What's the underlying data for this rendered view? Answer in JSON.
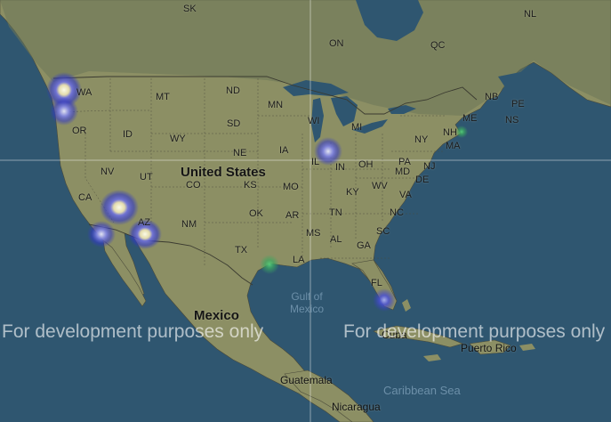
{
  "map": {
    "country_labels": {
      "united_states": "United States",
      "mexico": "Mexico"
    },
    "region_labels": {
      "sk": "SK",
      "on": "ON",
      "qc": "QC",
      "nl": "NL",
      "nb": "NB",
      "pe": "PE",
      "ns": "NS",
      "wa": "WA",
      "or": "OR",
      "id": "ID",
      "mt": "MT",
      "wy": "WY",
      "nd": "ND",
      "sd": "SD",
      "ne": "NE",
      "nv": "NV",
      "ut": "UT",
      "co": "CO",
      "ks": "KS",
      "ca": "CA",
      "az": "AZ",
      "nm": "NM",
      "ok": "OK",
      "tx": "TX",
      "mn": "MN",
      "wi": "WI",
      "ia": "IA",
      "mo": "MO",
      "ar": "AR",
      "la": "LA",
      "mi": "MI",
      "il": "IL",
      "in": "IN",
      "oh": "OH",
      "ky": "KY",
      "tn": "TN",
      "ms": "MS",
      "al": "AL",
      "ga": "GA",
      "fl": "FL",
      "sc": "SC",
      "nc": "NC",
      "va": "VA",
      "wv": "WV",
      "pa": "PA",
      "ny": "NY",
      "md": "MD",
      "de": "DE",
      "nj": "NJ",
      "me": "ME",
      "nh": "NH",
      "ma": "MA",
      "guatemala": "Guatemala",
      "nicaragua": "Nicaragua",
      "cuba": "Cuba",
      "puerto_rico": "Puerto Rico"
    },
    "water_labels": {
      "gulf": "Gulf of\nMexico",
      "caribbean": "Caribbean Sea"
    },
    "watermarks": {
      "left": "For development purposes only",
      "right": "For development purposes only"
    },
    "colors": {
      "ocean": "#2f5670",
      "land": "#9a9a6e",
      "land_dark": "#6e7a58",
      "border": "#3a3a30",
      "heat_low": "#3b3fd0",
      "heat_mid": "#39c06a",
      "heat_high": "#f4f6e8"
    },
    "heatmap_points": [
      {
        "place": "Seattle",
        "intensity": 1.0
      },
      {
        "place": "Portland",
        "intensity": 0.8
      },
      {
        "place": "Bay Area",
        "intensity": 1.0
      },
      {
        "place": "Los Angeles",
        "intensity": 0.7
      },
      {
        "place": "Phoenix",
        "intensity": 0.85
      },
      {
        "place": "Chicago",
        "intensity": 0.7
      },
      {
        "place": "Houston",
        "intensity": 0.3
      },
      {
        "place": "Boston",
        "intensity": 0.25
      },
      {
        "place": "Miami",
        "intensity": 0.6
      }
    ]
  }
}
